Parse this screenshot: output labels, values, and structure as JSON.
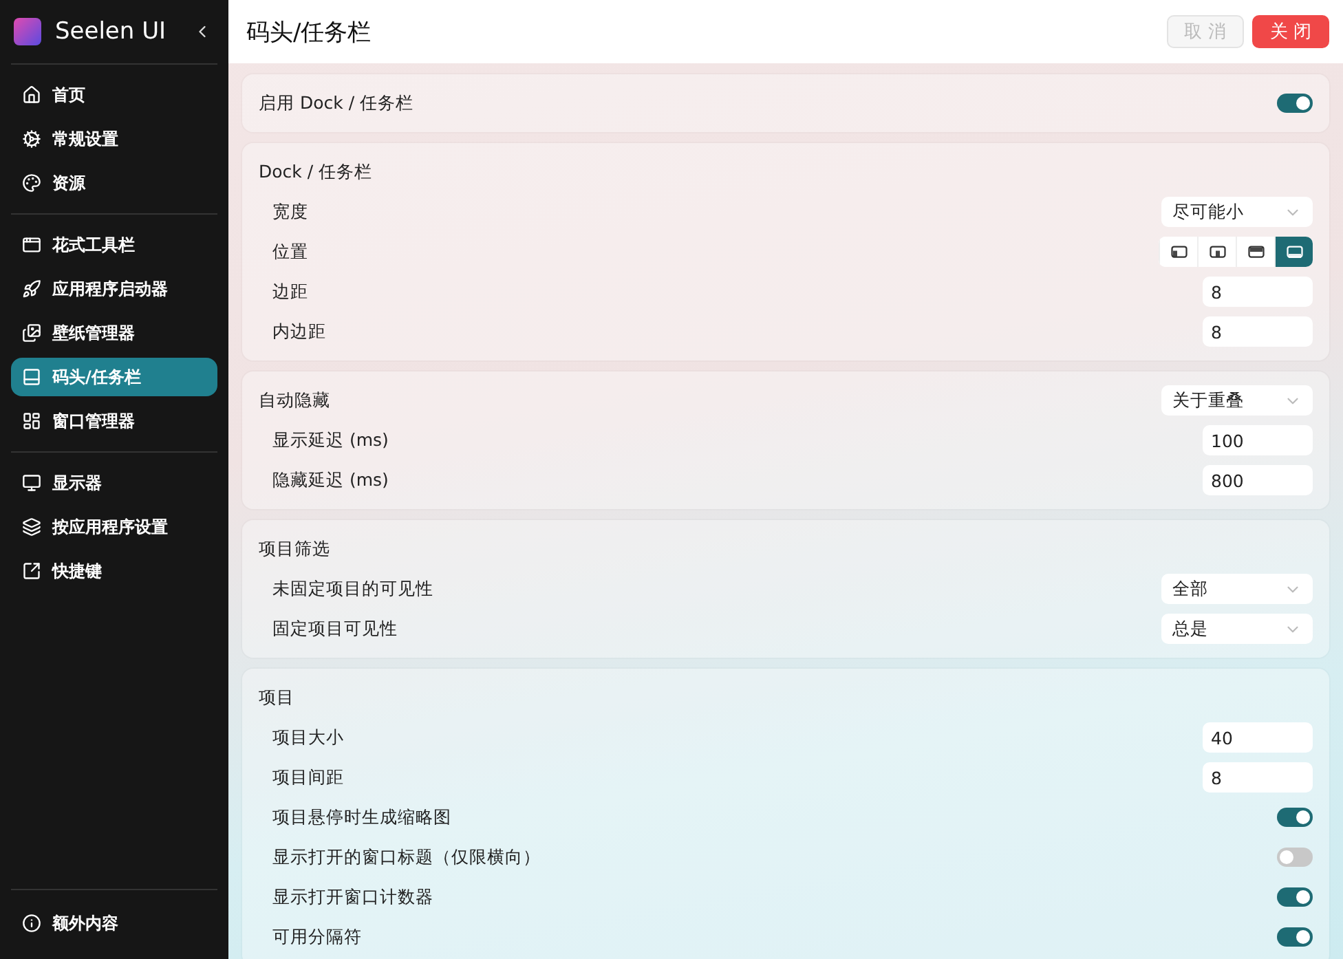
{
  "sidebar": {
    "app_name": "Seelen UI",
    "groups": [
      {
        "items": [
          {
            "label": "首页",
            "selected": false
          },
          {
            "label": "常规设置",
            "selected": false
          },
          {
            "label": "资源",
            "selected": false
          }
        ]
      },
      {
        "items": [
          {
            "label": "花式工具栏",
            "selected": false
          },
          {
            "label": "应用程序启动器",
            "selected": false
          },
          {
            "label": "壁纸管理器",
            "selected": false
          },
          {
            "label": "码头/任务栏",
            "selected": true
          },
          {
            "label": "窗口管理器",
            "selected": false
          }
        ]
      },
      {
        "items": [
          {
            "label": "显示器",
            "selected": false
          },
          {
            "label": "按应用程序设置",
            "selected": false
          },
          {
            "label": "快捷键",
            "selected": false
          }
        ]
      }
    ],
    "footer": {
      "label": "额外内容",
      "selected": false
    }
  },
  "header": {
    "title": "码头/任务栏",
    "buttons": [
      {
        "label": "取 消",
        "kind": "cancel",
        "disabled": true
      },
      {
        "label": "关 闭",
        "kind": "close",
        "disabled": false
      }
    ]
  },
  "sections": [
    {
      "title": "启用 Dock / 任务栏",
      "title_control": {
        "kind": "toggle",
        "on": true
      }
    },
    {
      "title": "Dock / 任务栏",
      "rows": [
        {
          "label": "宽度",
          "kind": "select",
          "value": "尽可能小"
        },
        {
          "label": "位置",
          "kind": "segmented",
          "options": [
            {
              "selected": false
            },
            {
              "selected": false
            },
            {
              "selected": false
            },
            {
              "selected": true
            }
          ]
        },
        {
          "label": "边距",
          "kind": "input",
          "value": "8"
        },
        {
          "label": "内边距",
          "kind": "input",
          "value": "8"
        }
      ]
    },
    {
      "title": "自动隐藏",
      "title_control": {
        "kind": "select",
        "value": "关于重叠"
      },
      "rows": [
        {
          "label": "显示延迟 (ms)",
          "kind": "input",
          "value": "100"
        },
        {
          "label": "隐藏延迟 (ms)",
          "kind": "input",
          "value": "800"
        }
      ]
    },
    {
      "title": "项目筛选",
      "rows": [
        {
          "label": "未固定项目的可见性",
          "kind": "select",
          "value": "全部"
        },
        {
          "label": "固定项目可见性",
          "kind": "select",
          "value": "总是"
        }
      ]
    },
    {
      "title": "项目",
      "rows": [
        {
          "label": "项目大小",
          "kind": "input",
          "value": "40"
        },
        {
          "label": "项目间距",
          "kind": "input",
          "value": "8"
        },
        {
          "label": "项目悬停时生成缩略图",
          "kind": "toggle",
          "on": true
        },
        {
          "label": "显示打开的窗口标题（仅限横向）",
          "kind": "toggle",
          "on": false
        },
        {
          "label": "显示打开窗口计数器",
          "kind": "toggle",
          "on": true
        },
        {
          "label": "可用分隔符",
          "kind": "toggle",
          "on": true
        }
      ]
    }
  ]
}
